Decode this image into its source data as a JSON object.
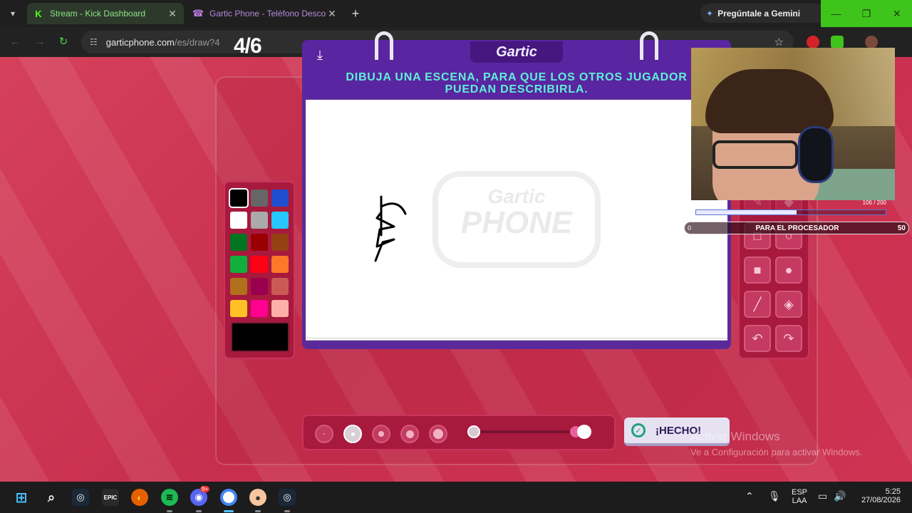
{
  "browser": {
    "tabs": [
      {
        "title": "Stream - Kick Dashboard",
        "active": true
      },
      {
        "title": "Gartic Phone - Teléfono Descon",
        "active": false
      }
    ],
    "gemini_label": "Pregúntale a Gemini",
    "url_host": "garticphone.com",
    "url_path": "/es/draw?4"
  },
  "game": {
    "round": "4/6",
    "logo": "Gartic",
    "instruction_line1": "DIBUJA UNA ESCENA, PARA QUE LOS OTROS JUGADOR",
    "instruction_line2": "PUEDAN DESCRIBIRLA.",
    "watermark_top": "Gartic",
    "watermark_bottom": "PHONE",
    "done_label": "¡HECHO!",
    "palette": [
      "#000000",
      "#666666",
      "#1f4fd0",
      "#ffffff",
      "#aaaaaa",
      "#26c9ff",
      "#017420",
      "#990000",
      "#964112",
      "#11b03c",
      "#ff0013",
      "#ff7829",
      "#b0701c",
      "#99004e",
      "#cb5a57",
      "#ffc126",
      "#ff008f",
      "#feafa8"
    ],
    "selected_color": "#000000",
    "brush_sizes": 5,
    "selected_brush": 2,
    "opacity_level": 1.0
  },
  "overlay": {
    "counter": "106 / 200",
    "goal_start": "0",
    "goal_title": "PARA EL PROCESADOR",
    "goal_end": "50",
    "progress": 0.53
  },
  "watermark": {
    "line1": "Activar Windows",
    "line2": "Ve a Configuración para activar Windows."
  },
  "taskbar": {
    "lang1": "ESP",
    "lang2": "LAA",
    "time": "5:25",
    "date": "27/08/2026",
    "discord_badge": "9+"
  }
}
